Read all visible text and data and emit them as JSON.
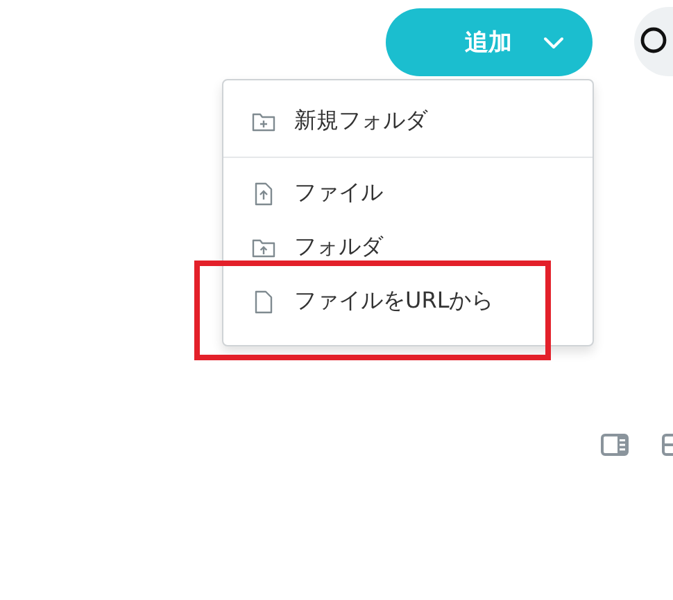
{
  "add_button": {
    "label": "追加"
  },
  "menu": {
    "items": [
      {
        "kind": "new-folder",
        "label": "新規フォルダ",
        "highlighted": false
      },
      {
        "kind": "divider"
      },
      {
        "kind": "upload-file",
        "label": "ファイル",
        "highlighted": false
      },
      {
        "kind": "upload-folder",
        "label": "フォルダ",
        "highlighted": false
      },
      {
        "kind": "file",
        "label": "ファイルをURLから",
        "highlighted": true
      }
    ]
  }
}
